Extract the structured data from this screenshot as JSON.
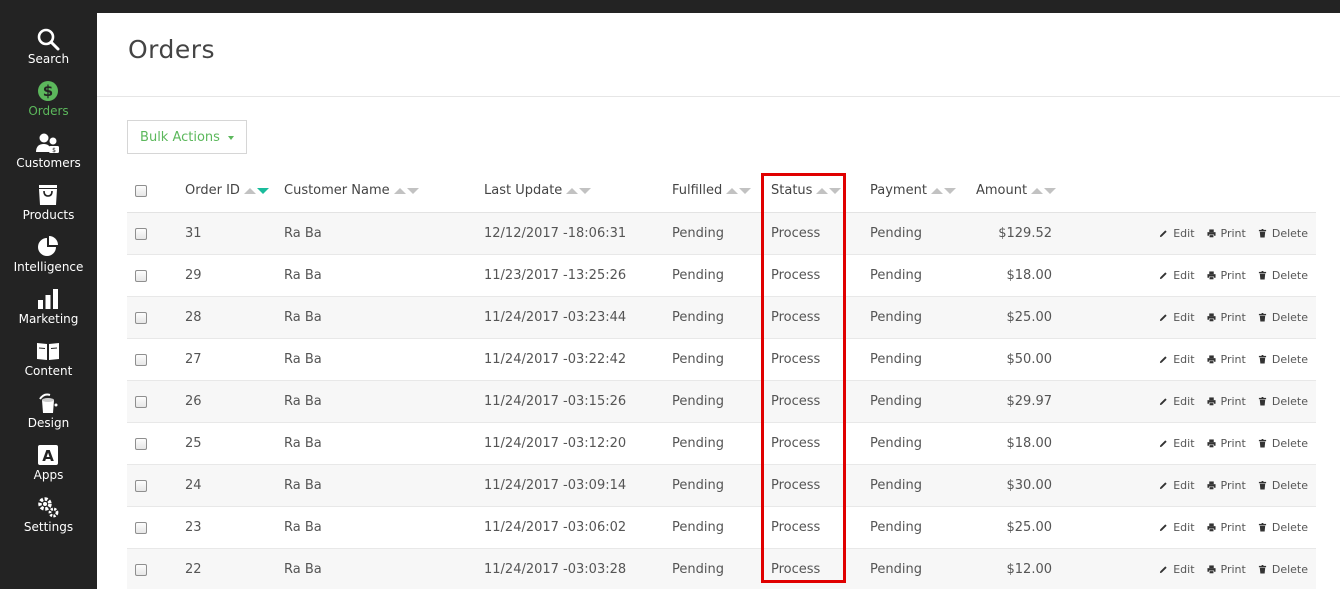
{
  "sidebar": {
    "items": [
      {
        "label": "Search",
        "icon": "search-icon"
      },
      {
        "label": "Orders",
        "icon": "dollar-icon",
        "active": true
      },
      {
        "label": "Customers",
        "icon": "customers-icon"
      },
      {
        "label": "Products",
        "icon": "shopping-bag-icon"
      },
      {
        "label": "Intelligence",
        "icon": "pie-chart-icon"
      },
      {
        "label": "Marketing",
        "icon": "bar-chart-icon"
      },
      {
        "label": "Content",
        "icon": "book-icon"
      },
      {
        "label": "Design",
        "icon": "paint-bucket-icon"
      },
      {
        "label": "Apps",
        "icon": "app-letter-icon"
      },
      {
        "label": "Settings",
        "icon": "gears-icon"
      }
    ]
  },
  "page": {
    "title": "Orders",
    "bulk_actions_label": "Bulk Actions"
  },
  "table": {
    "headers": {
      "order_id": "Order ID",
      "customer_name": "Customer Name",
      "last_update": "Last Update",
      "fulfilled": "Fulfilled",
      "status": "Status",
      "payment": "Payment",
      "amount": "Amount"
    },
    "actions": {
      "edit": "Edit",
      "print": "Print",
      "delete": "Delete"
    },
    "rows": [
      {
        "id": "31",
        "name": "Ra Ba",
        "updated": "12/12/2017 -18:06:31",
        "fulfilled": "Pending",
        "status": "Process",
        "payment": "Pending",
        "amount": "$129.52"
      },
      {
        "id": "29",
        "name": "Ra Ba",
        "updated": "11/23/2017 -13:25:26",
        "fulfilled": "Pending",
        "status": "Process",
        "payment": "Pending",
        "amount": "$18.00"
      },
      {
        "id": "28",
        "name": "Ra Ba",
        "updated": "11/24/2017 -03:23:44",
        "fulfilled": "Pending",
        "status": "Process",
        "payment": "Pending",
        "amount": "$25.00"
      },
      {
        "id": "27",
        "name": "Ra Ba",
        "updated": "11/24/2017 -03:22:42",
        "fulfilled": "Pending",
        "status": "Process",
        "payment": "Pending",
        "amount": "$50.00"
      },
      {
        "id": "26",
        "name": "Ra Ba",
        "updated": "11/24/2017 -03:15:26",
        "fulfilled": "Pending",
        "status": "Process",
        "payment": "Pending",
        "amount": "$29.97"
      },
      {
        "id": "25",
        "name": "Ra Ba",
        "updated": "11/24/2017 -03:12:20",
        "fulfilled": "Pending",
        "status": "Process",
        "payment": "Pending",
        "amount": "$18.00"
      },
      {
        "id": "24",
        "name": "Ra Ba",
        "updated": "11/24/2017 -03:09:14",
        "fulfilled": "Pending",
        "status": "Process",
        "payment": "Pending",
        "amount": "$30.00"
      },
      {
        "id": "23",
        "name": "Ra Ba",
        "updated": "11/24/2017 -03:06:02",
        "fulfilled": "Pending",
        "status": "Process",
        "payment": "Pending",
        "amount": "$25.00"
      },
      {
        "id": "22",
        "name": "Ra Ba",
        "updated": "11/24/2017 -03:03:28",
        "fulfilled": "Pending",
        "status": "Process",
        "payment": "Pending",
        "amount": "$12.00"
      }
    ]
  },
  "colors": {
    "sidebar_bg": "#232323",
    "accent_green": "#5cb85c",
    "sort_active": "#1abc9c",
    "highlight": "#e00000"
  }
}
